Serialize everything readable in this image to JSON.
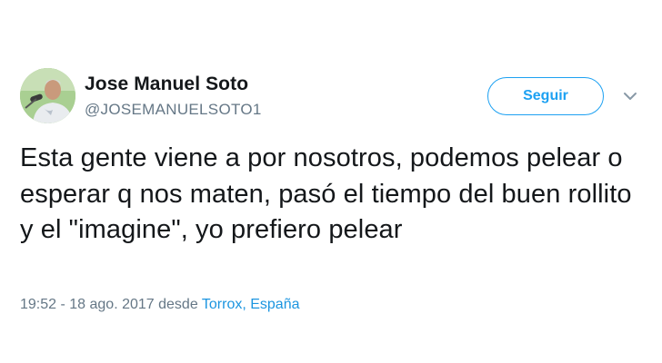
{
  "user": {
    "display_name": "Jose Manuel Soto",
    "handle": "@JOSEMANUELSOTO1",
    "avatar_icon": "profile-photo"
  },
  "actions": {
    "follow_label": "Seguir",
    "more_icon": "chevron-down-icon"
  },
  "tweet": {
    "text": "Esta gente viene a por nosotros, podemos pelear o esperar q nos maten, pasó el tiempo del buen rollito y el \"imagine\", yo prefiero pelear"
  },
  "meta": {
    "timestamp": "19:52 - 18 ago. 2017",
    "from_label": " desde ",
    "location": "Torrox, España"
  },
  "colors": {
    "accent": "#1da1f2",
    "link": "#1b95e0",
    "secondary_text": "#657786",
    "primary_text": "#14171a"
  }
}
